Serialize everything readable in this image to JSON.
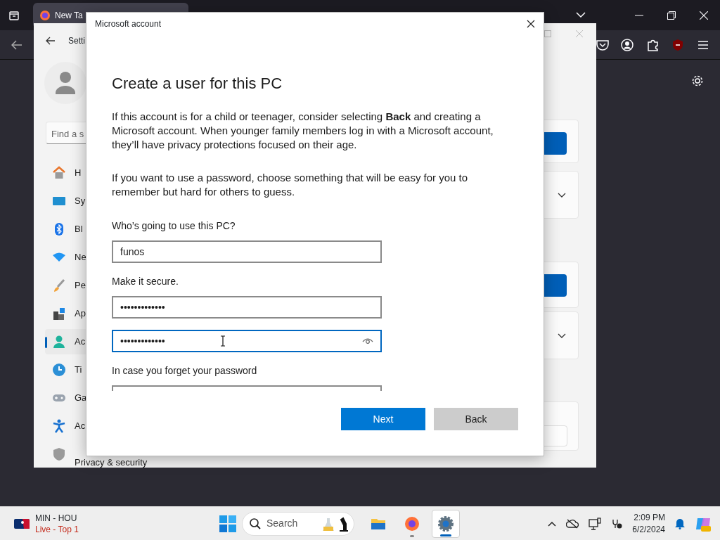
{
  "browser": {
    "tab": {
      "label": "New Ta",
      "selected": true
    }
  },
  "settings": {
    "title": "Setti",
    "search": {
      "placeholder": "Find a s"
    },
    "nav": [
      {
        "label": "H",
        "selected": false
      },
      {
        "label": "Sy",
        "selected": false
      },
      {
        "label": "Bl",
        "selected": false
      },
      {
        "label": "Ne",
        "selected": false
      },
      {
        "label": "Pe",
        "selected": false
      },
      {
        "label": "Ap",
        "selected": false
      },
      {
        "label": "Ac",
        "selected": true
      },
      {
        "label": "Ti",
        "selected": false
      },
      {
        "label": "Ga",
        "selected": false
      },
      {
        "label": "Ac",
        "selected": false
      },
      {
        "label": "Privacy & security",
        "selected": false
      }
    ]
  },
  "dialog": {
    "title": "Microsoft account",
    "heading": "Create a user for this PC",
    "paragraphs": [
      "If this account is for a child or teenager, consider selecting **Back** and creating a Microsoft account. When younger family members log in with a Microsoft account, they’ll have privacy protections focused on their age.",
      "If you want to use a password, choose something that will be easy for you to remember but hard for others to guess."
    ],
    "fields": [
      {
        "kind": "label",
        "text": "Who’s going to use this PC?"
      },
      {
        "kind": "input",
        "value": "funos",
        "focused": false
      },
      {
        "kind": "label",
        "text": "Make it secure."
      },
      {
        "kind": "input",
        "value": "•••••••••••••",
        "focused": false
      },
      {
        "kind": "input",
        "value": "•••••••••••••",
        "focused": true
      },
      {
        "kind": "label",
        "text": "In case you forget your password"
      },
      {
        "kind": "cut"
      }
    ],
    "buttons": [
      {
        "label": "Next",
        "primary": true
      },
      {
        "label": "Back",
        "primary": false
      }
    ]
  },
  "taskbar": {
    "widget": {
      "title": "MIN - HOU",
      "status": "Live - Top 1"
    },
    "search": {
      "placeholder": "Search"
    },
    "apps": [
      {
        "kind": "folder",
        "selected": false,
        "running": false
      },
      {
        "kind": "firefox",
        "selected": false,
        "running": true
      },
      {
        "kind": "settings",
        "selected": true,
        "running": true
      }
    ],
    "time": "2:09 PM",
    "date": "6/2/2024"
  }
}
